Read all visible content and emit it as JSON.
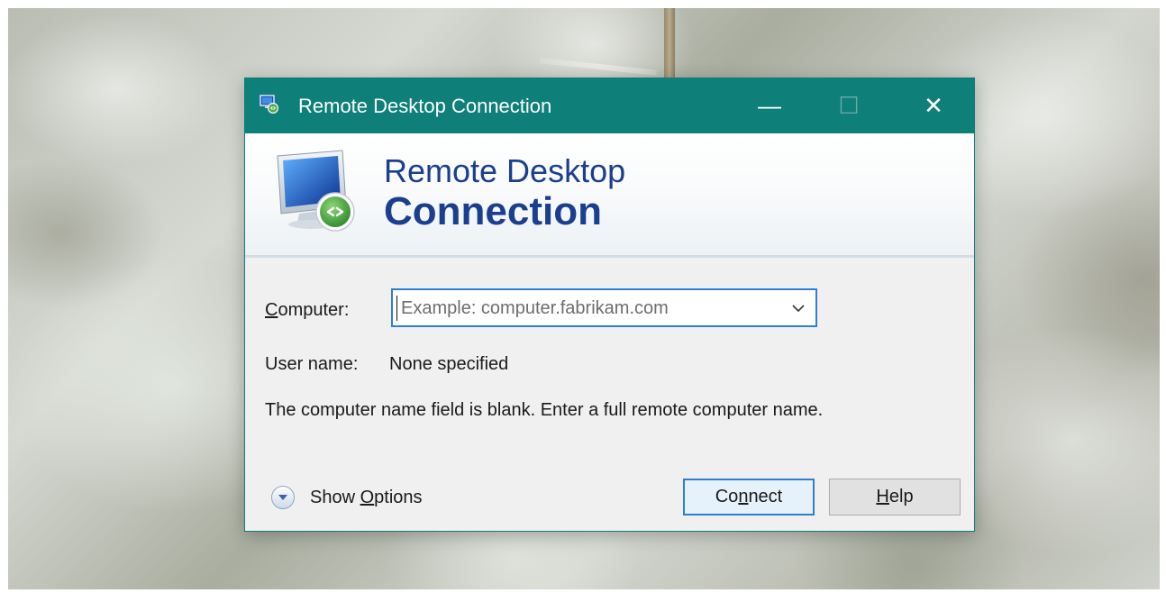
{
  "window": {
    "title": "Remote Desktop Connection",
    "minimize_glyph": "—",
    "maximize_glyph": "☐",
    "close_glyph": "✕",
    "accent_color": "#0e7f79"
  },
  "banner": {
    "line1": "Remote Desktop",
    "line2": "Connection"
  },
  "form": {
    "computer_label_pre": "",
    "computer_label_key": "C",
    "computer_label_post": "omputer:",
    "computer_value": "",
    "computer_placeholder": "Example: computer.fabrikam.com",
    "username_label": "User name:",
    "username_value": "None specified",
    "message": "The computer name field is blank. Enter a full remote computer name."
  },
  "footer": {
    "show_options_pre": "Show ",
    "show_options_key": "O",
    "show_options_post": "ptions",
    "connect_pre": "Co",
    "connect_key": "n",
    "connect_post": "nect",
    "help_pre": "",
    "help_key": "H",
    "help_post": "elp"
  },
  "icons": {
    "title": "remote-desktop-icon",
    "banner": "monitor-connection-icon",
    "dropdown": "chevron-down-icon",
    "options": "expand-circle-icon"
  }
}
